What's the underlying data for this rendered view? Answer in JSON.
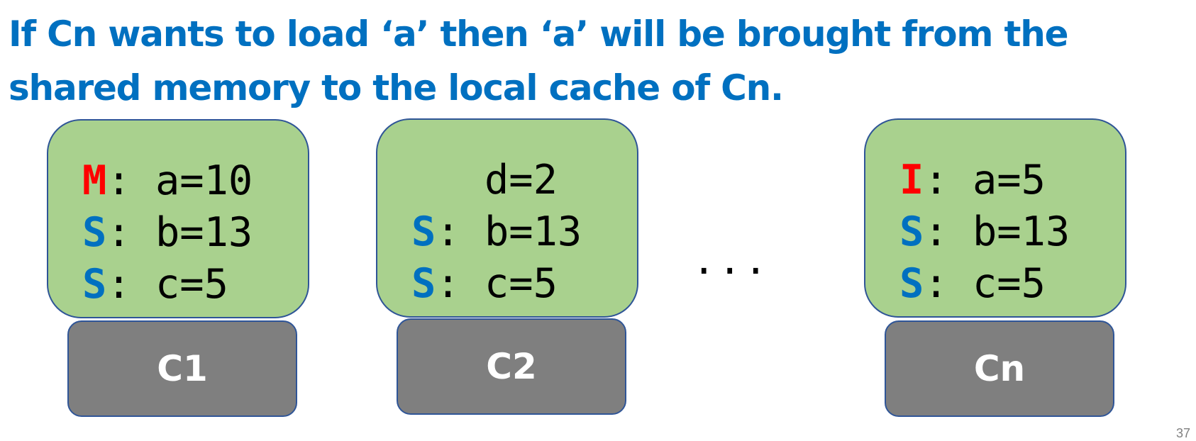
{
  "title": "If Cn wants to load ‘a’ then ‘a’ will be brought from the shared memory to the local cache of Cn.",
  "colors": {
    "title": "#0070c0",
    "cache_fill": "#a9d18e",
    "outline": "#2f5597",
    "core_fill": "#7f7f7f",
    "state_M": "#ff0000",
    "state_I": "#ff0000",
    "state_S": "#0070c0"
  },
  "caches": [
    {
      "core": "C1",
      "lines": [
        {
          "state": "M",
          "sep": ": ",
          "entry": "a=10"
        },
        {
          "state": "S",
          "sep": ": ",
          "entry": "b=13"
        },
        {
          "state": "S",
          "sep": ": ",
          "entry": "c=5"
        }
      ]
    },
    {
      "core": "C2",
      "lines": [
        {
          "state": "",
          "sep": "   ",
          "entry": "d=2"
        },
        {
          "state": "S",
          "sep": ": ",
          "entry": "b=13"
        },
        {
          "state": "S",
          "sep": ": ",
          "entry": "c=5"
        }
      ]
    },
    {
      "core": "Cn",
      "lines": [
        {
          "state": "I",
          "sep": ": ",
          "entry": "a=5"
        },
        {
          "state": "S",
          "sep": ": ",
          "entry": "b=13"
        },
        {
          "state": "S",
          "sep": ": ",
          "entry": "c=5"
        }
      ]
    }
  ],
  "ellipsis": "...",
  "page_number": "37"
}
